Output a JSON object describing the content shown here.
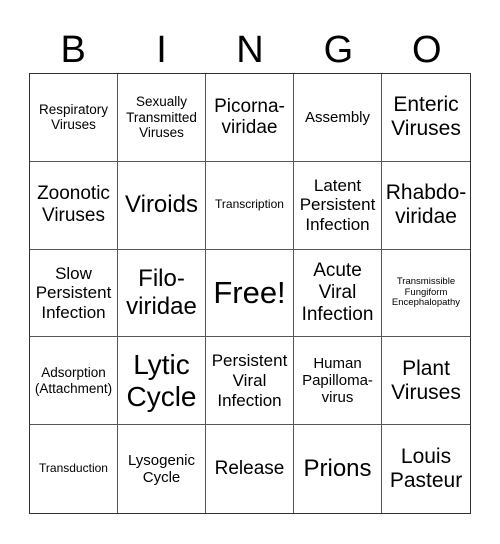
{
  "header": {
    "letters": [
      "B",
      "I",
      "N",
      "G",
      "O"
    ]
  },
  "board": {
    "rows": [
      [
        "Respiratory\nViruses",
        "Sexually\nTransmitted\nViruses",
        "Picorna-\nviridae",
        "Assembly",
        "Enteric\nViruses"
      ],
      [
        "Zoonotic\nViruses",
        "Viroids",
        "Transcription",
        "Latent\nPersistent\nInfection",
        "Rhabdo-\nviridae"
      ],
      [
        "Slow\nPersistent\nInfection",
        "Filo-\nviridae",
        "Free!",
        "Acute\nViral\nInfection",
        "Transmissible\nFungiform\nEncephalopathy"
      ],
      [
        "Adsorption\n(Attachment)",
        "Lytic\nCycle",
        "Persistent\nViral\nInfection",
        "Human\nPapilloma-\nvirus",
        "Plant\nViruses"
      ],
      [
        "Transduction",
        "Lysogenic\nCycle",
        "Release",
        "Prions",
        "Louis\nPasteur"
      ]
    ]
  }
}
